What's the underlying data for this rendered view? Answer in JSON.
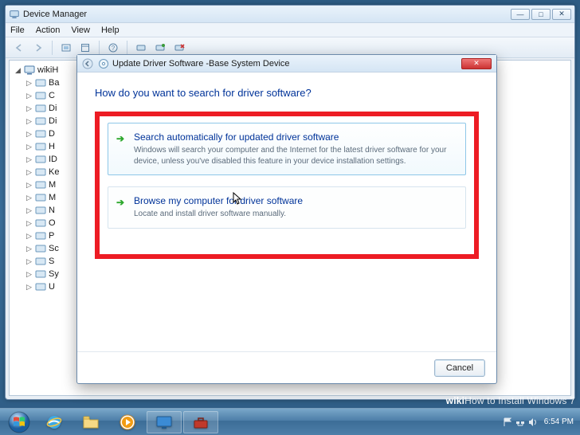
{
  "dm": {
    "title": "Device Manager",
    "menu": [
      "File",
      "Action",
      "View",
      "Help"
    ],
    "win_btn_min": "—",
    "win_btn_max": "□",
    "win_btn_close": "✕",
    "tree_root": "wikiH",
    "tree": [
      {
        "label": "Ba"
      },
      {
        "label": "C"
      },
      {
        "label": "Di"
      },
      {
        "label": "Di"
      },
      {
        "label": "D"
      },
      {
        "label": "H"
      },
      {
        "label": "ID"
      },
      {
        "label": "Ke"
      },
      {
        "label": "M"
      },
      {
        "label": "M"
      },
      {
        "label": "N"
      },
      {
        "label": "O"
      },
      {
        "label": "P"
      },
      {
        "label": "Sc"
      },
      {
        "label": "S"
      },
      {
        "label": "Sy"
      },
      {
        "label": "U"
      }
    ]
  },
  "wizard": {
    "title_prefix": "Update Driver Software - ",
    "title_device": "Base System Device",
    "question": "How do you want to search for driver software?",
    "opt1": {
      "title": "Search automatically for updated driver software",
      "desc": "Windows will search your computer and the Internet for the latest driver software for your device, unless you've disabled this feature in your device installation settings."
    },
    "opt2": {
      "title": "Browse my computer for driver software",
      "desc": "Locate and install driver software manually."
    },
    "cancel": "Cancel",
    "close_glyph": "✕"
  },
  "taskbar": {
    "time": "6:54 PM"
  },
  "watermark": {
    "brand": "wiki",
    "text": "How to Install Windows 7"
  }
}
